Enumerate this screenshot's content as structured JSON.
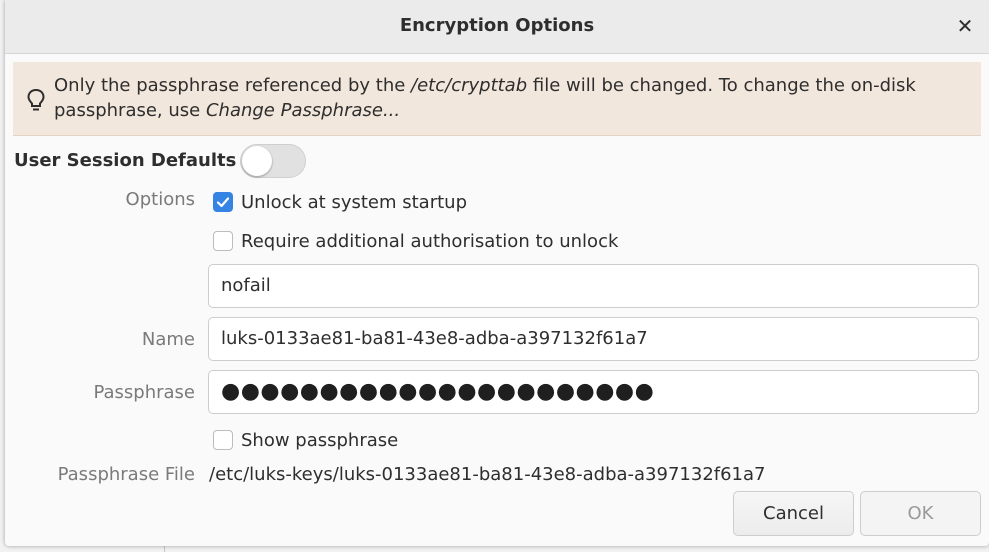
{
  "dialog": {
    "title": "Encryption Options"
  },
  "info": {
    "text_before": "Only the passphrase referenced by the ",
    "crypttab_path": "/etc/crypttab",
    "text_middle": " file will be changed. To change the on-disk passphrase, use ",
    "action_name": "Change Passphrase...",
    "icon": "lightbulb-icon"
  },
  "session_defaults": {
    "label": "User Session Defaults",
    "enabled": false
  },
  "options": {
    "label": "Options",
    "unlock_at_startup": {
      "label": "Unlock at system startup",
      "checked": true
    },
    "require_auth": {
      "label": "Require additional authorisation to unlock",
      "checked": false
    },
    "options_value": "nofail"
  },
  "name": {
    "label": "Name",
    "value": "luks-0133ae81-ba81-43e8-adba-a397132f61a7"
  },
  "passphrase": {
    "label": "Passphrase",
    "masked_value": "●●●●●●●●●●●●●●●●●●●●●●",
    "show_label": "Show passphrase",
    "show_checked": false
  },
  "passphrase_file": {
    "label": "Passphrase File",
    "value": "/etc/luks-keys/luks-0133ae81-ba81-43e8-adba-a397132f61a7"
  },
  "buttons": {
    "cancel": "Cancel",
    "ok": "OK"
  },
  "colors": {
    "accent": "#3584e4",
    "infobar_bg": "#f2e7dc"
  }
}
